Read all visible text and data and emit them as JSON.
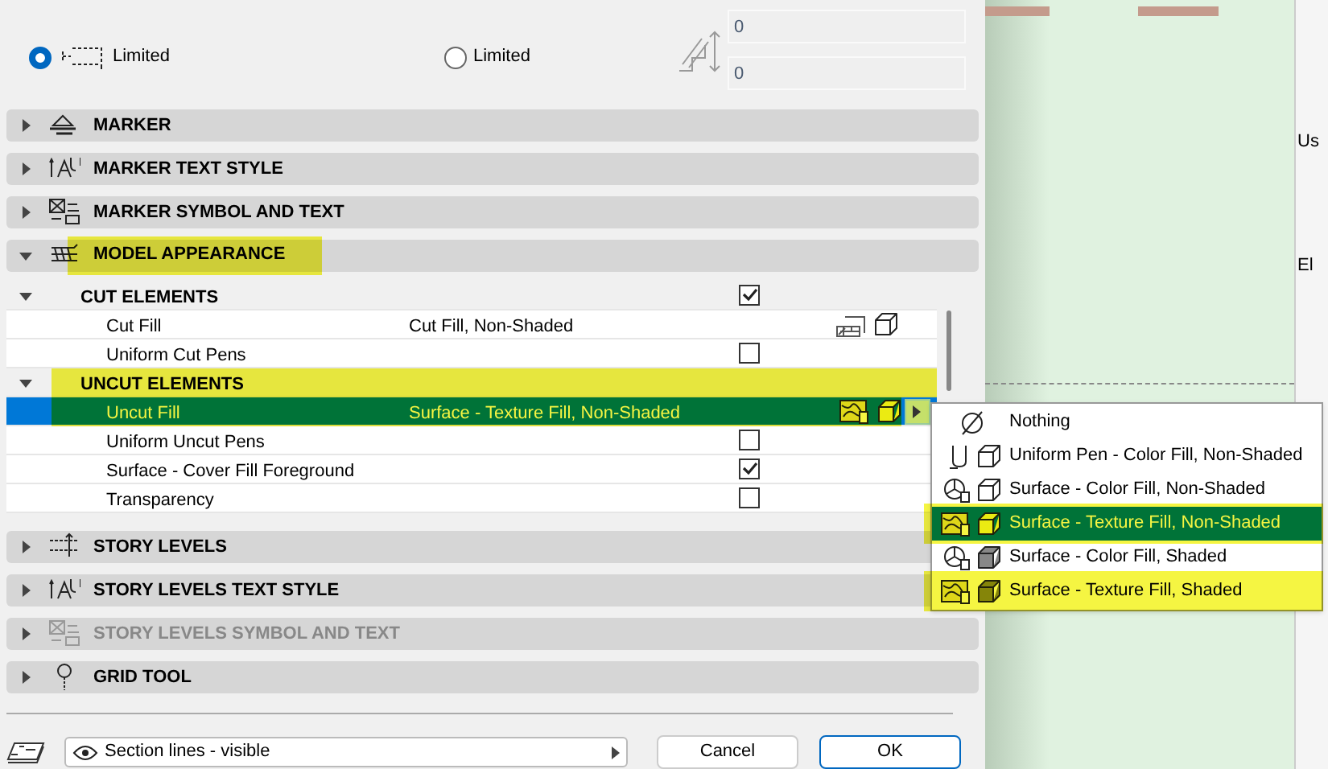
{
  "limit_options": [
    {
      "label": "Limited",
      "selected": true
    },
    {
      "label": "Limited",
      "selected": false
    }
  ],
  "offset_fields": [
    {
      "value": "0"
    },
    {
      "value": "0"
    }
  ],
  "sections_top": [
    {
      "kind": "marker",
      "label": "MARKER",
      "expanded": false,
      "disabled": false,
      "highlighted": false
    },
    {
      "kind": "textstyle",
      "label": "MARKER TEXT STYLE",
      "expanded": false,
      "disabled": false,
      "highlighted": false
    },
    {
      "kind": "symboltext",
      "label": "MARKER SYMBOL AND TEXT",
      "expanded": false,
      "disabled": false,
      "highlighted": false
    },
    {
      "kind": "model",
      "label": "MODEL APPEARANCE",
      "expanded": true,
      "disabled": false,
      "highlighted": true
    }
  ],
  "model_appearance_rows": [
    {
      "kind": "group",
      "label": "CUT ELEMENTS",
      "expanded": true,
      "checked": true,
      "highlighted": false,
      "selected": false
    },
    {
      "kind": "cutfill",
      "label": "Cut Fill",
      "value": "Cut Fill, Non-Shaded",
      "highlighted": false,
      "selected": false
    },
    {
      "kind": "check",
      "label": "Uniform Cut Pens",
      "checked": false,
      "highlighted": false,
      "selected": false
    },
    {
      "kind": "group",
      "label": "UNCUT ELEMENTS",
      "expanded": true,
      "highlighted": true,
      "selected": false
    },
    {
      "kind": "texturefill",
      "label": "Uncut Fill",
      "value": "Surface - Texture Fill, Non-Shaded",
      "highlighted": true,
      "selected": true
    },
    {
      "kind": "check",
      "label": "Uniform Uncut Pens",
      "checked": false,
      "highlighted": false,
      "selected": false
    },
    {
      "kind": "check",
      "label": "Surface - Cover Fill Foreground",
      "checked": true,
      "highlighted": false,
      "selected": false
    },
    {
      "kind": "check",
      "label": "Transparency",
      "checked": false,
      "highlighted": false,
      "selected": false
    }
  ],
  "fill_menu": [
    {
      "kind": "nothing",
      "label": "Nothing",
      "selected": false,
      "highlighted": false
    },
    {
      "kind": "pen",
      "label": "Uniform Pen - Color Fill, Non-Shaded",
      "shaded": false,
      "selected": false,
      "highlighted": false
    },
    {
      "kind": "color",
      "label": "Surface - Color Fill, Non-Shaded",
      "shaded": false,
      "selected": false,
      "highlighted": false
    },
    {
      "kind": "texture",
      "label": "Surface - Texture Fill, Non-Shaded",
      "shaded": false,
      "selected": true,
      "highlighted": true
    },
    {
      "kind": "color",
      "label": "Surface - Color Fill, Shaded",
      "shaded": true,
      "selected": false,
      "highlighted": false
    },
    {
      "kind": "texture",
      "label": "Surface - Texture Fill, Shaded",
      "shaded": true,
      "selected": false,
      "highlighted": true
    }
  ],
  "sections_bottom": [
    {
      "kind": "levels",
      "label": "STORY LEVELS",
      "expanded": false,
      "disabled": false,
      "highlighted": false
    },
    {
      "kind": "textstyle",
      "label": "STORY LEVELS TEXT STYLE",
      "expanded": false,
      "disabled": false,
      "highlighted": false
    },
    {
      "kind": "symboltext",
      "label": "STORY LEVELS SYMBOL AND TEXT",
      "expanded": false,
      "disabled": true,
      "highlighted": false
    },
    {
      "kind": "grid",
      "label": "GRID TOOL",
      "expanded": false,
      "disabled": false,
      "highlighted": false
    }
  ],
  "footer": {
    "view_select": "Section lines - visible",
    "buttons": [
      "Cancel",
      "OK"
    ]
  },
  "side_panel_labels": [
    "Us",
    "El"
  ]
}
